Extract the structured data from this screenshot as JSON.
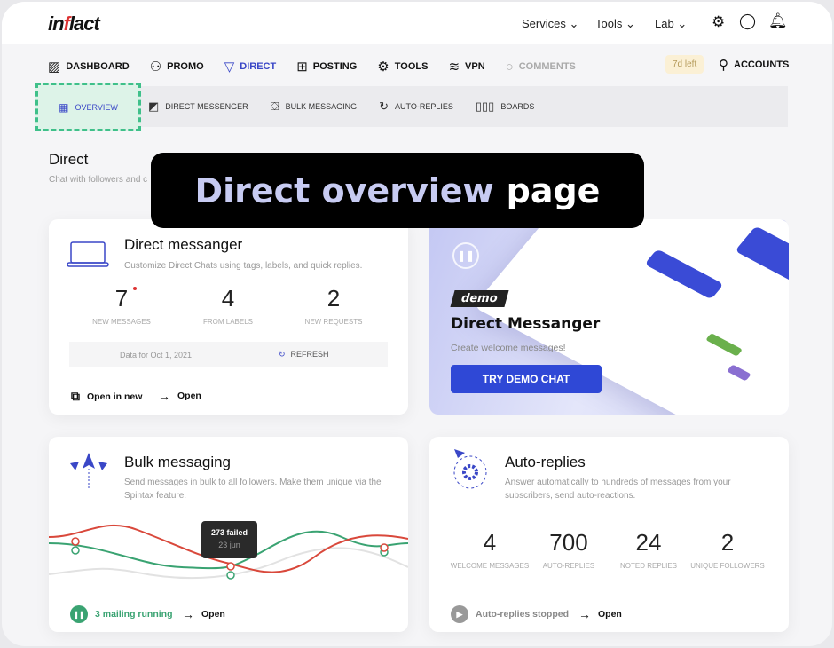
{
  "header": {
    "logo": "inflact",
    "menu": [
      {
        "label": "Services"
      },
      {
        "label": "Tools"
      },
      {
        "label": "Lab"
      }
    ],
    "icons": [
      "gear-icon",
      "chat-icon",
      "bell-icon"
    ]
  },
  "nav": {
    "items": [
      {
        "label": "DASHBOARD",
        "icon": "chart-icon"
      },
      {
        "label": "PROMO",
        "icon": "users-icon"
      },
      {
        "label": "DIRECT",
        "icon": "funnel-icon",
        "active": true
      },
      {
        "label": "POSTING",
        "icon": "plus-square-icon"
      },
      {
        "label": "TOOLS",
        "icon": "gears-icon"
      },
      {
        "label": "VPN",
        "icon": "wifi-icon"
      },
      {
        "label": "COMMENTS",
        "icon": "comment-icon",
        "disabled": true
      }
    ],
    "trial_badge": "7d left",
    "accounts": "ACCOUNTS"
  },
  "subnav": {
    "items": [
      {
        "label": "OVERVIEW",
        "active": true
      },
      {
        "label": "DIRECT MESSENGER"
      },
      {
        "label": "BULK MESSAGING"
      },
      {
        "label": "AUTO-REPLIES"
      },
      {
        "label": "BOARDS"
      }
    ]
  },
  "page": {
    "title": "Direct",
    "description": "Chat with followers and c"
  },
  "banner": {
    "highlight": "Direct overview",
    "rest": "page"
  },
  "messenger": {
    "title": "Direct messanger",
    "description": "Customize Direct Chats using tags, labels, and quick replies.",
    "stats": [
      {
        "value": "7",
        "label": "NEW MESSAGES"
      },
      {
        "value": "4",
        "label": "FROM LABELS"
      },
      {
        "value": "2",
        "label": "NEW REQUESTS"
      }
    ],
    "data_for": "Data for Oct 1, 2021",
    "refresh": "REFRESH",
    "open_new": "Open in new",
    "open": "Open"
  },
  "demo": {
    "tag": "demo",
    "title": "Direct Messanger",
    "subtitle": "Create welcome messages!",
    "button": "TRY DEMO CHAT"
  },
  "bulk": {
    "title": "Bulk messaging",
    "description": "Send messages in bulk to all followers. Make them unique via the Spintax feature.",
    "tooltip_value": "273 failed",
    "tooltip_date": "23 jun",
    "status": "3 mailing running",
    "open": "Open",
    "colors": {
      "red": "#d9483b",
      "green": "#3aa372",
      "gray": "#e0e0e0"
    }
  },
  "autoreplies": {
    "title": "Auto-replies",
    "description": "Answer automatically to hundreds of messages from your subscribers, send auto-reactions.",
    "stats": [
      {
        "value": "4",
        "label": "WELCOME MESSAGES"
      },
      {
        "value": "700",
        "label": "AUTO-REPLIES"
      },
      {
        "value": "24",
        "label": "NOTED REPLIES"
      },
      {
        "value": "2",
        "label": "UNIQUE FOLLOWERS"
      }
    ],
    "status": "Auto-replies stopped",
    "open": "Open"
  }
}
